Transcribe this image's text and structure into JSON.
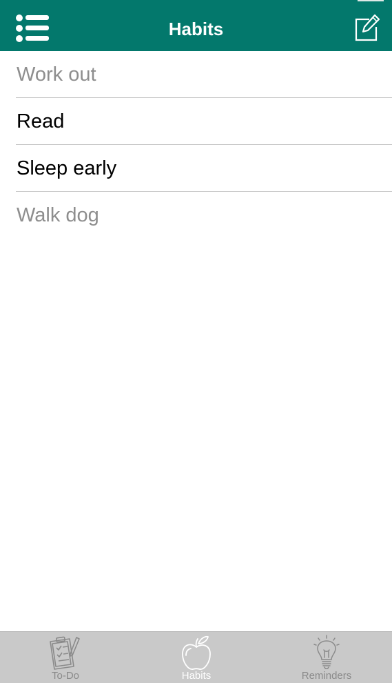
{
  "header": {
    "title": "Habits",
    "menu_icon": "list-icon",
    "edit_icon": "compose-icon",
    "background_color": "#03786c"
  },
  "habits": [
    {
      "label": "Work out",
      "state": "dimmed"
    },
    {
      "label": "Read",
      "state": "normal"
    },
    {
      "label": "Sleep early",
      "state": "normal"
    },
    {
      "label": "Walk dog",
      "state": "dimmed"
    }
  ],
  "tabbar": {
    "tabs": [
      {
        "label": "To-Do",
        "icon": "clipboard-icon",
        "active": false
      },
      {
        "label": "Habits",
        "icon": "apple-icon",
        "active": true
      },
      {
        "label": "Reminders",
        "icon": "lightbulb-icon",
        "active": false
      }
    ],
    "background_color": "#c9c9c9"
  }
}
